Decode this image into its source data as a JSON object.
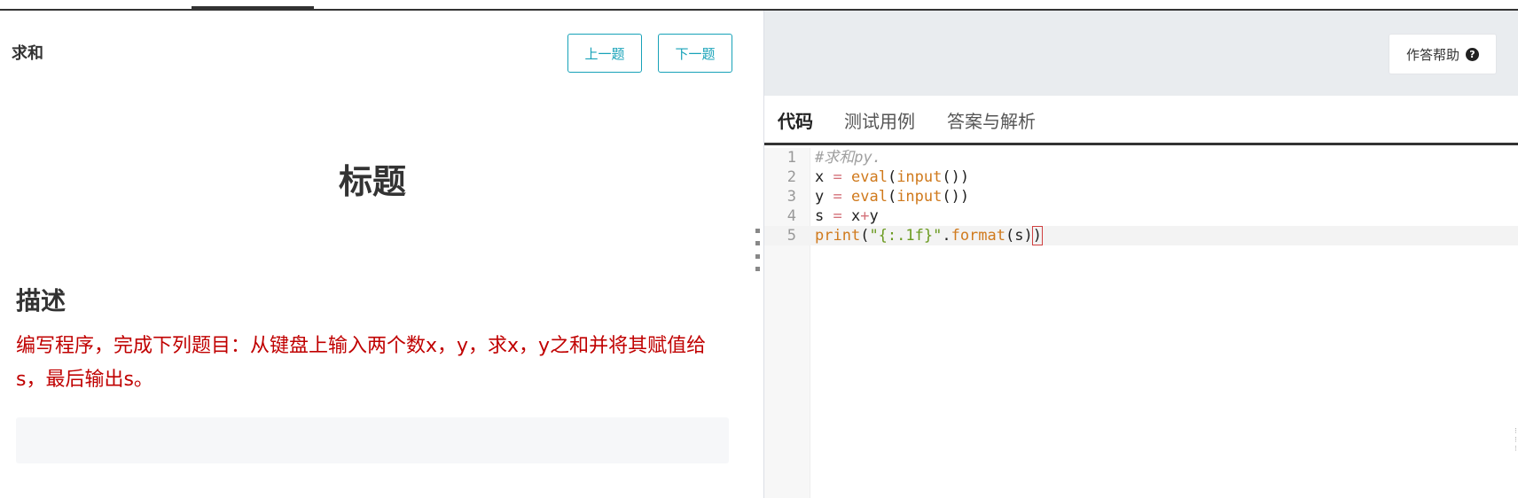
{
  "problem": {
    "name": "求和",
    "prev_label": "上一题",
    "next_label": "下一题",
    "doc_title": "标题",
    "section_heading": "描述",
    "description": "编写程序，完成下列题目：从键盘上输入两个数x，y，求x，y之和并将其赋值给s，最后输出s。"
  },
  "header": {
    "help_label": "作答帮助",
    "help_icon": "question-circle-icon"
  },
  "tabs": [
    {
      "label": "代码",
      "active": true
    },
    {
      "label": "测试用例",
      "active": false
    },
    {
      "label": "答案与解析",
      "active": false
    }
  ],
  "editor": {
    "lines": [
      {
        "no": "1",
        "text": "#求和py."
      },
      {
        "no": "2",
        "text": "x = eval(input())"
      },
      {
        "no": "3",
        "text": "y = eval(input())"
      },
      {
        "no": "4",
        "text": "s = x+y"
      },
      {
        "no": "5",
        "text": "print(\"{:.1f}\".format(s))"
      }
    ],
    "current_line": 5
  },
  "colors": {
    "accent": "#17a2b8",
    "description_text": "#c00000",
    "header_bg": "#e9ecef"
  }
}
